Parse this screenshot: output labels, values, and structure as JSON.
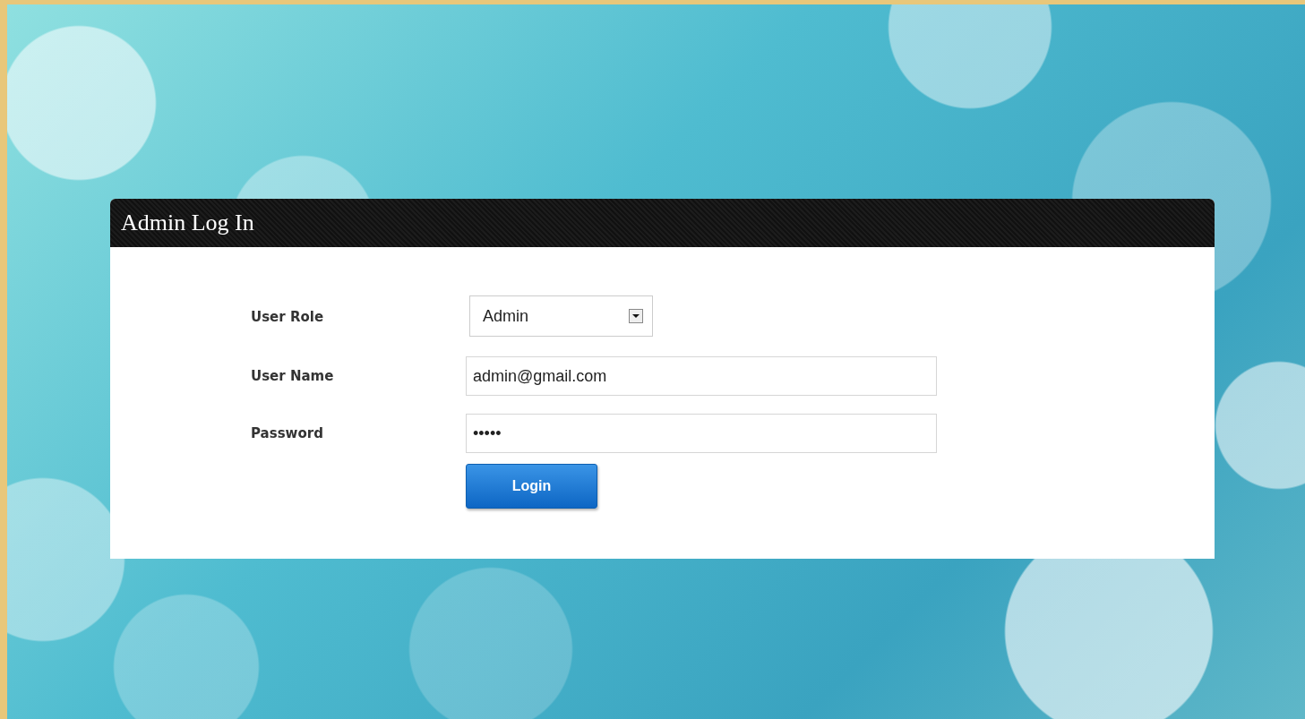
{
  "panel": {
    "title": "Admin Log In"
  },
  "form": {
    "fields": [
      {
        "kind": "select",
        "label": "User Role",
        "value": "Admin"
      },
      {
        "kind": "text",
        "label": "User Name",
        "value": "admin@gmail.com"
      },
      {
        "kind": "password",
        "label": "Password",
        "value": "•••••"
      }
    ],
    "submit": "Login"
  }
}
